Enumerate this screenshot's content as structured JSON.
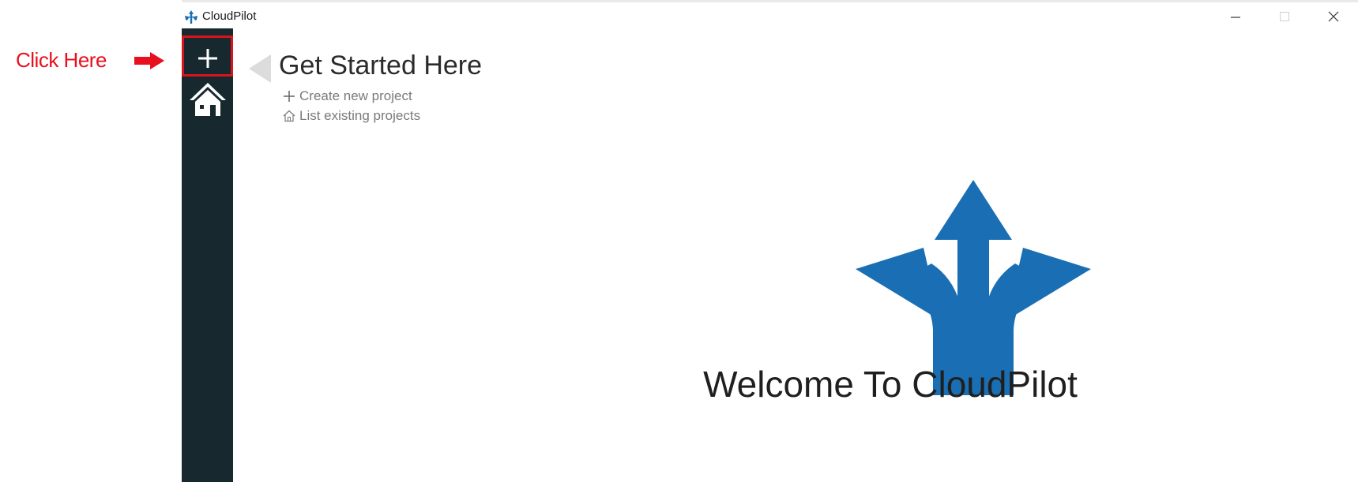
{
  "annotation": {
    "label": "Click Here",
    "color": "#e8101e"
  },
  "window": {
    "title": "CloudPilot",
    "controls": [
      "minimize-icon",
      "maximize-icon",
      "close-icon"
    ]
  },
  "sidebar": {
    "background": "#17292f",
    "items": [
      {
        "name": "add",
        "icon": "plus-icon"
      },
      {
        "name": "home",
        "icon": "home-icon"
      }
    ]
  },
  "main": {
    "heading": "Get Started Here",
    "links": [
      {
        "label": "Create new project",
        "icon": "plus-icon"
      },
      {
        "label": "List existing projects",
        "icon": "home-outline-icon"
      }
    ],
    "welcome": "Welcome To CloudPilot",
    "hero_icon": "split-arrows-icon",
    "accent": "#1a6fb4"
  }
}
